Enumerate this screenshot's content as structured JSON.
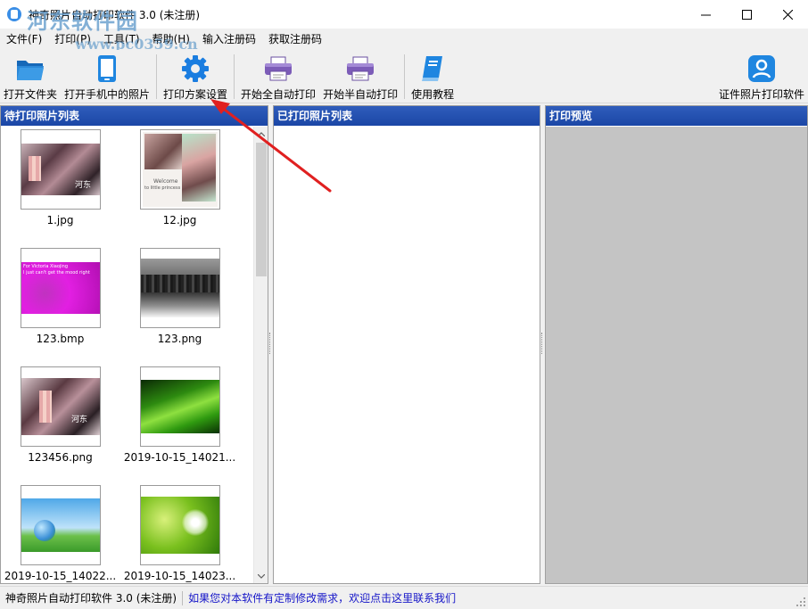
{
  "window": {
    "title": "神奇照片自动打印软件 3.0 (未注册)",
    "watermark": "河东软件园",
    "watermark_url": "www.pc0359.cn"
  },
  "menu": [
    {
      "label": "文件(F)"
    },
    {
      "label": "打印(P)"
    },
    {
      "label": "工具(T)"
    },
    {
      "label": "帮助(H)"
    },
    {
      "label": "输入注册码"
    },
    {
      "label": "获取注册码"
    }
  ],
  "toolbar": {
    "open_folder": "打开文件夹",
    "open_phone": "打开手机中的照片",
    "print_settings": "打印方案设置",
    "start_auto_print": "开始全自动打印",
    "start_semi_auto_print": "开始半自动打印",
    "tutorial": "使用教程",
    "id_photo_software": "证件照片打印软件"
  },
  "panels": {
    "pending": {
      "header": "待打印照片列表",
      "files": [
        "1.jpg",
        "12.jpg",
        "123.bmp",
        "123.png",
        "123456.png",
        "2019-10-15_14021...",
        "2019-10-15_14022...",
        "2019-10-15_14023..."
      ]
    },
    "printed": {
      "header": "已打印照片列表"
    },
    "preview": {
      "header": "打印预览"
    }
  },
  "thumb_text": {
    "hedong": "河东",
    "hedong2": "河东",
    "bmp_line1": "For Victoria Xiaojing",
    "bmp_line2": "I just can't get the mood right",
    "welcome": "Welcome",
    "little": "to little princess"
  },
  "status": {
    "left": "神奇照片自动打印软件 3.0 (未注册)",
    "link": "如果您对本软件有定制修改需求，欢迎点击这里联系我们"
  },
  "colors": {
    "panel_header": "#1f4aa8",
    "link": "#1515c8",
    "annotation_arrow": "#e02020"
  }
}
